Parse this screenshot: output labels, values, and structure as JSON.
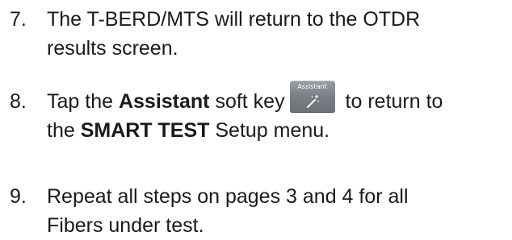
{
  "steps": [
    {
      "number": "7.",
      "lines": [
        "The T-BERD/MTS will return to the OTDR",
        "results screen."
      ]
    },
    {
      "number": "8.",
      "line1_pre": "Tap the ",
      "line1_bold": "Assistant",
      "line1_mid": " soft key",
      "line1_post": " to return to",
      "line2_pre": "the ",
      "line2_bold": "SMART TEST",
      "line2_post": " Setup menu.",
      "softkey_label": "Assistant",
      "softkey_icon": "magic-wand-icon"
    },
    {
      "number": "9.",
      "lines": [
        "Repeat all steps on pages 3 and 4 for all",
        "Fibers under test."
      ]
    }
  ]
}
